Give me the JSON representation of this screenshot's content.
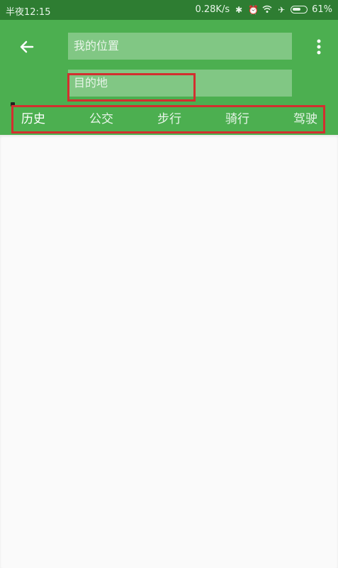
{
  "status_bar": {
    "time": "半夜12:15",
    "network_speed": "0.28K/s",
    "battery": "61%",
    "icons": [
      "bluetooth-icon",
      "alarm-icon",
      "wifi-icon",
      "airplane-icon",
      "battery-icon"
    ]
  },
  "toolbar": {
    "back_icon": "arrow-left-icon",
    "more_icon": "more-vert-icon"
  },
  "route": {
    "origin_placeholder": "我的位置",
    "destination_placeholder": "目的地"
  },
  "tabs": [
    {
      "label": "历史",
      "active": true
    },
    {
      "label": "公交",
      "active": false
    },
    {
      "label": "步行",
      "active": false
    },
    {
      "label": "骑行",
      "active": false
    },
    {
      "label": "驾驶",
      "active": false
    }
  ],
  "colors": {
    "status_bar": "#2e7d32",
    "app_bar": "#4caf50",
    "input_background": "#81c784",
    "highlight": "#d32f2f",
    "page_background": "#fafafa"
  }
}
